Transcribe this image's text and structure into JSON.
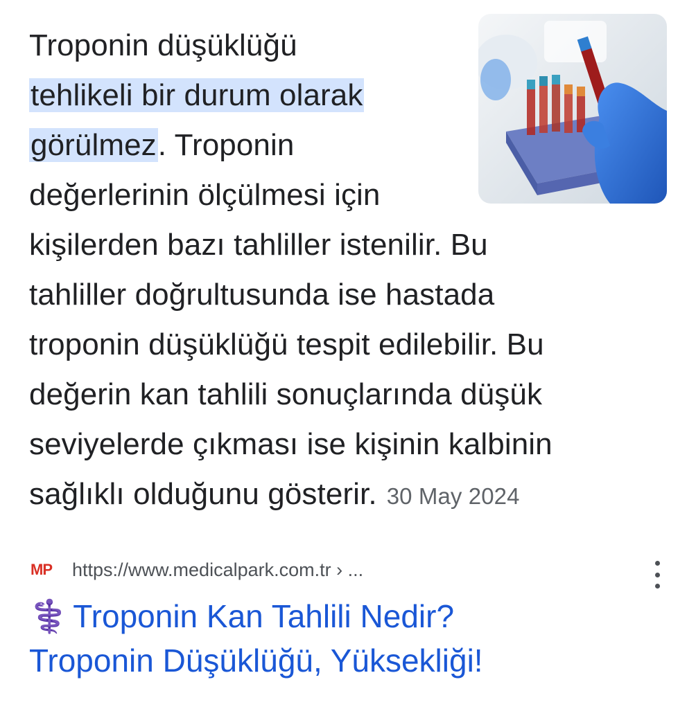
{
  "snippet": {
    "lines": [
      {
        "text": "Troponin düşüklüğü"
      },
      {
        "highlight": "tehlikeli bir durum olarak"
      },
      {
        "highlight": "görülmez",
        "text": ". Troponin"
      },
      {
        "text": "değerlerinin ölçülmesi için"
      },
      {
        "text": "kişilerden bazı tahliller istenilir. Bu"
      },
      {
        "text": "tahliller doğrultusunda ise hastada"
      },
      {
        "text": "troponin düşüklüğü tespit edilebilir. Bu"
      },
      {
        "text": "değerin kan tahlili sonuçlarında düşük"
      },
      {
        "text": "seviyelerde çıkması ise kişinin kalbinin"
      },
      {
        "text": "sağlıklı olduğunu gösterir."
      }
    ],
    "date": "30 May 2024"
  },
  "thumbnail": {
    "description_icon": "blood-test-tubes-image",
    "colors": {
      "bg": "#e8eef2",
      "glove": "#2f6fd6",
      "blood": "#b3261e",
      "rack": "#5d6fb8"
    }
  },
  "source": {
    "favicon_text": "MP",
    "url": "https://www.medicalpark.com.tr › ...",
    "menu_icon": "more-vert-icon"
  },
  "result": {
    "title_line1": "Troponin Kan Tahlili Nedir?",
    "title_line2": "Troponin Düşüklüğü, Yüksekliği!",
    "title_emoji": "⚕️",
    "link_color": "#1a57d6"
  }
}
